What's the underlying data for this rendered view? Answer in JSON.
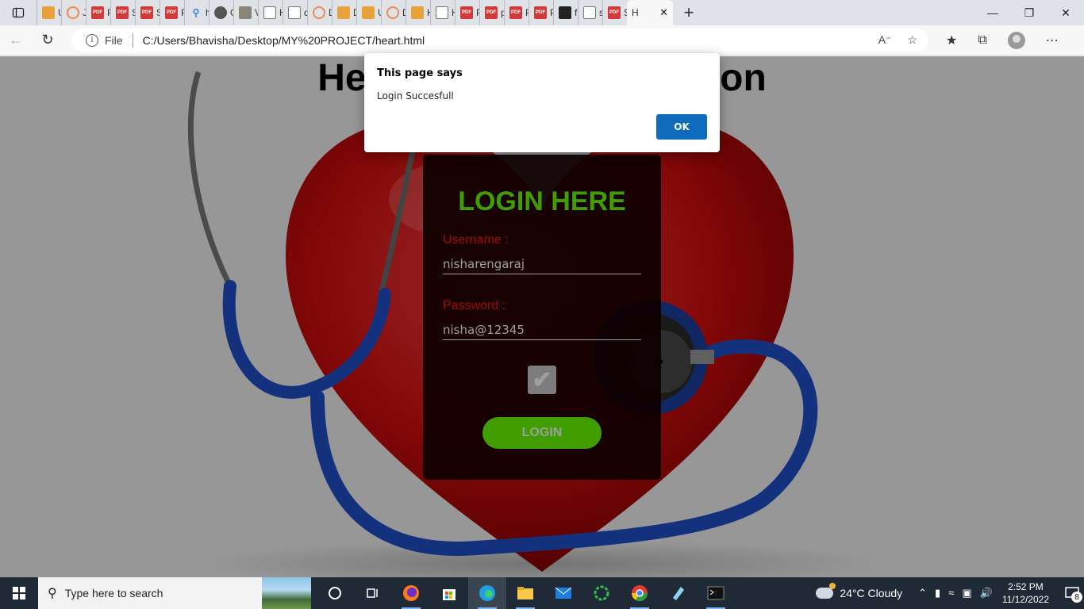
{
  "browser": {
    "tabs": [
      {
        "label": "U",
        "icon": "book-icon"
      },
      {
        "label": "Ju",
        "icon": "loading-ring-icon"
      },
      {
        "label": "P",
        "icon": "pdf-icon"
      },
      {
        "label": "S",
        "icon": "pdf-icon"
      },
      {
        "label": "S",
        "icon": "pdf-icon"
      },
      {
        "label": "P",
        "icon": "pdf-icon"
      },
      {
        "label": "h",
        "icon": "search-icon"
      },
      {
        "label": "G",
        "icon": "github-icon"
      },
      {
        "label": "V",
        "icon": "image-icon"
      },
      {
        "label": "H",
        "icon": "document-icon"
      },
      {
        "label": "d",
        "icon": "document-icon"
      },
      {
        "label": "D",
        "icon": "loading-ring-icon"
      },
      {
        "label": "D",
        "icon": "book-icon"
      },
      {
        "label": "U",
        "icon": "book-icon"
      },
      {
        "label": "D",
        "icon": "loading-ring-icon"
      },
      {
        "label": "H",
        "icon": "book-icon"
      },
      {
        "label": "H",
        "icon": "document-icon"
      },
      {
        "label": "P",
        "icon": "pdf-icon"
      },
      {
        "label": "p",
        "icon": "pdf-icon"
      },
      {
        "label": "P",
        "icon": "pdf-icon"
      },
      {
        "label": "P",
        "icon": "pdf-icon"
      },
      {
        "label": "fi",
        "icon": "file-icon"
      },
      {
        "label": "si",
        "icon": "document-icon"
      },
      {
        "label": "S",
        "icon": "pdf-icon"
      }
    ],
    "active_tab": {
      "label": "H"
    },
    "pdf_badge": "PDF",
    "address": {
      "scheme": "File",
      "url": "C:/Users/Bhavisha/Desktop/MY%20PROJECT/heart.html"
    }
  },
  "page": {
    "title": "Heart Disease Prediction",
    "login": {
      "heading": "LOGIN HERE",
      "username_label": "Username :",
      "username_value": "nisharengaraj",
      "password_label": "Password :",
      "password_value": "nisha@12345",
      "checkbox_checked": true,
      "button_label": "LOGIN"
    }
  },
  "alert": {
    "title": "This page says",
    "message": "Login Succesfull",
    "ok_label": "OK"
  },
  "taskbar": {
    "search_placeholder": "Type here to search",
    "weather": "24°C  Cloudy",
    "time": "2:52 PM",
    "date": "11/12/2022",
    "notification_count": "8"
  },
  "colors": {
    "accent_green": "#6aff00",
    "label_red": "#ff1414",
    "ok_blue": "#0f6cbd"
  }
}
